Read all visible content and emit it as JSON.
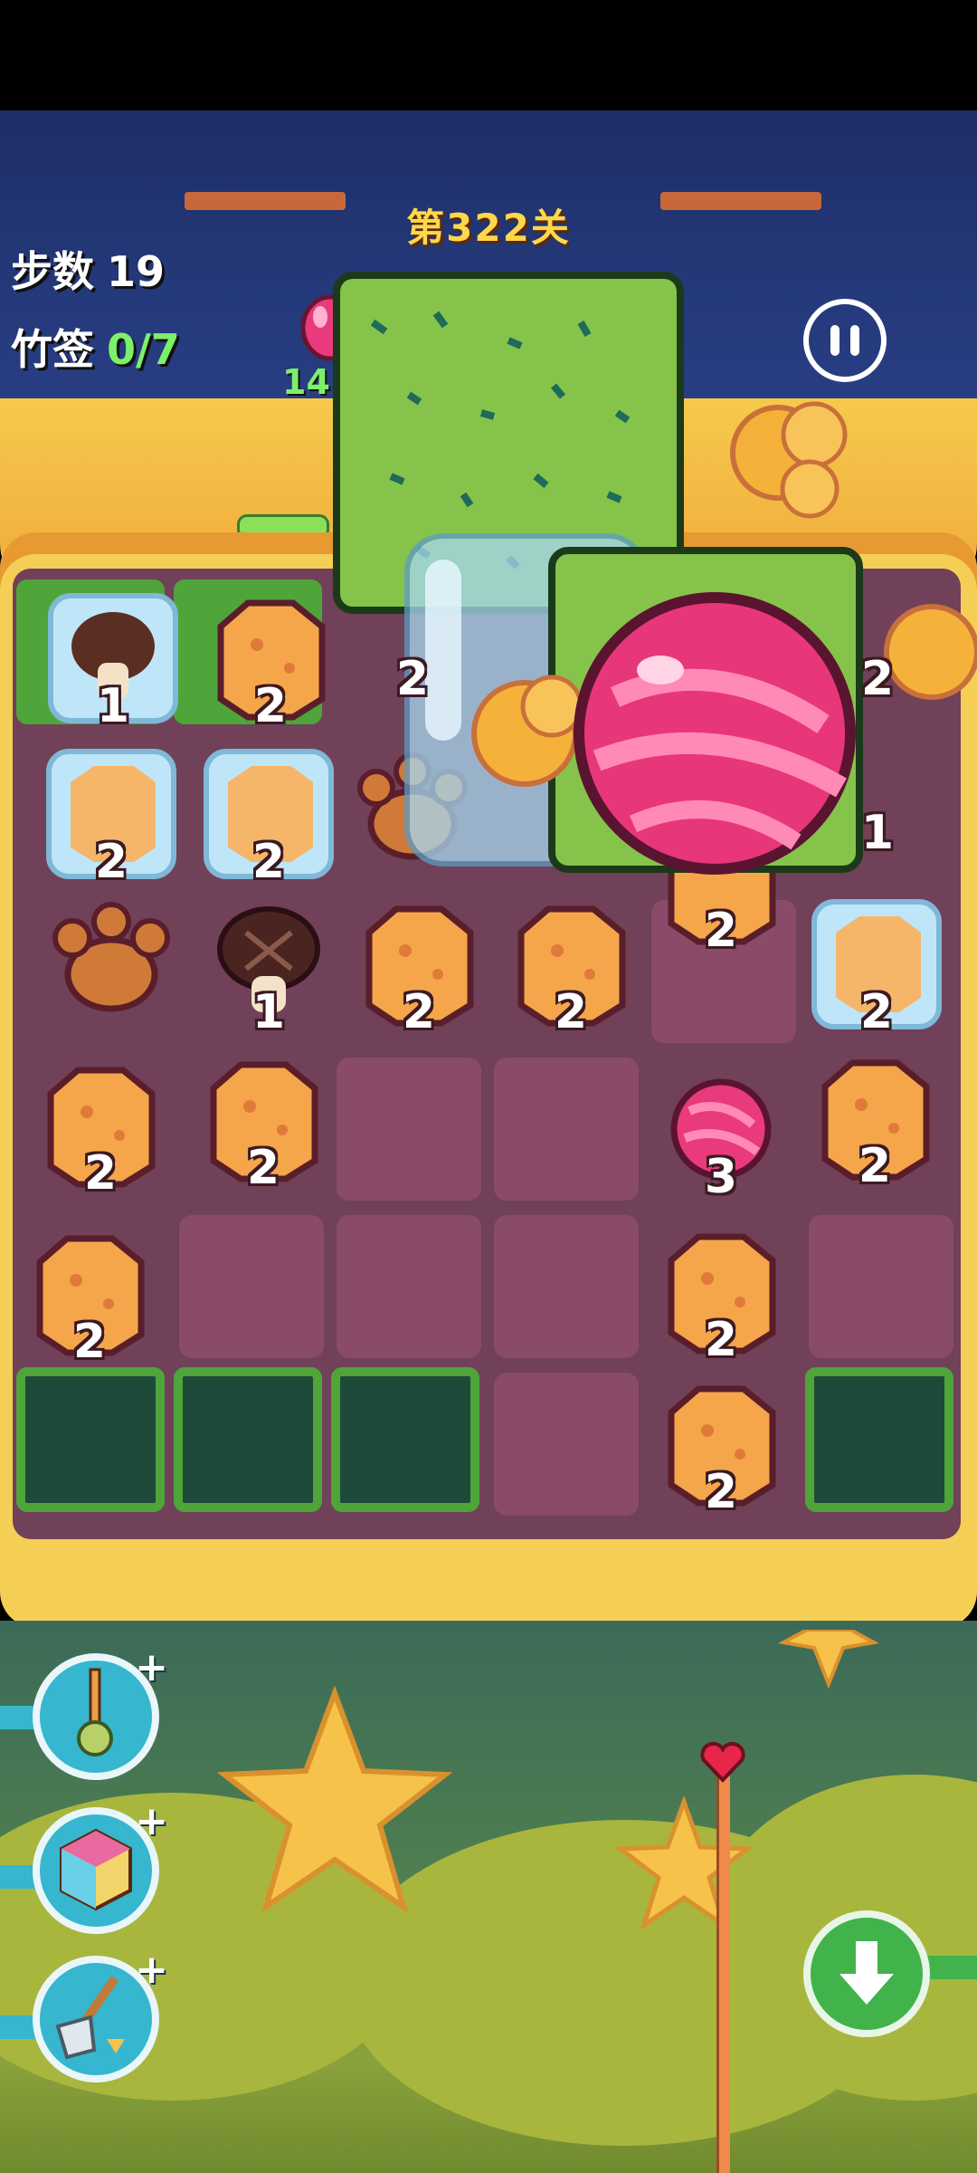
{
  "header": {
    "level_title": "第322关",
    "moves_label": "步数",
    "moves_value": "19",
    "goal_label": "竹签",
    "goal_value": "0/7",
    "goal_count": "14"
  },
  "board": {
    "tiles": [
      {
        "type": "mushroom-ice",
        "num": "1"
      },
      {
        "type": "sponge",
        "num": "2"
      },
      {
        "type": "sponge-ice",
        "num": "2"
      },
      {
        "type": "sponge-ice",
        "num": "2"
      },
      {
        "type": "paw",
        "num": ""
      },
      {
        "type": "mushroom",
        "num": "1"
      },
      {
        "type": "sponge",
        "num": "2"
      },
      {
        "type": "sponge",
        "num": "2"
      },
      {
        "type": "sponge",
        "num": "2"
      },
      {
        "type": "sponge-ice",
        "num": "2"
      },
      {
        "type": "sponge",
        "num": "2"
      },
      {
        "type": "sponge",
        "num": "2"
      },
      {
        "type": "candy",
        "num": "3"
      },
      {
        "type": "sponge",
        "num": "2"
      },
      {
        "type": "sponge",
        "num": "2"
      },
      {
        "type": "sponge",
        "num": "2"
      },
      {
        "type": "sponge",
        "num": "2"
      }
    ],
    "hidden_numbers": [
      "2",
      "1",
      "2"
    ]
  },
  "tools": [
    {
      "name": "pin-tool"
    },
    {
      "name": "cube-tool"
    },
    {
      "name": "shovel-tool"
    }
  ],
  "colors": {
    "accent": "#ffd84a",
    "goal": "#7df06a",
    "board": "#704158",
    "cell": "#8a4a6a"
  }
}
